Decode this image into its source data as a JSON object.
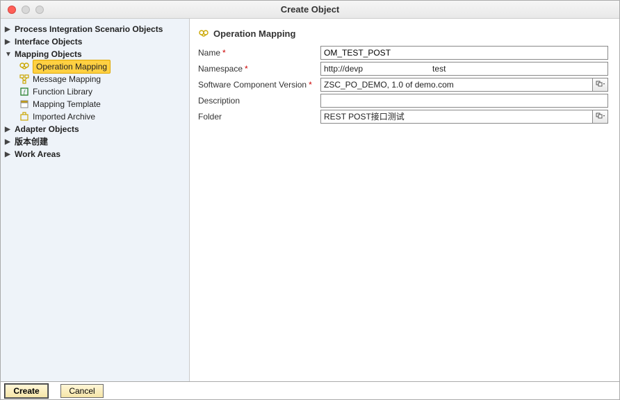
{
  "window": {
    "title": "Create Object"
  },
  "tree": {
    "items": [
      {
        "label": "Process Integration Scenario Objects",
        "expanded": false
      },
      {
        "label": "Interface Objects",
        "expanded": false
      },
      {
        "label": "Mapping Objects",
        "expanded": true,
        "children": [
          {
            "label": "Operation Mapping",
            "icon": "op-mapping",
            "selected": true
          },
          {
            "label": "Message Mapping",
            "icon": "msg-mapping"
          },
          {
            "label": "Function Library",
            "icon": "func-lib"
          },
          {
            "label": "Mapping Template",
            "icon": "map-tmpl"
          },
          {
            "label": "Imported Archive",
            "icon": "imp-arch"
          }
        ]
      },
      {
        "label": "Adapter Objects",
        "expanded": false
      },
      {
        "label": "版本创建",
        "expanded": false
      },
      {
        "label": "Work Areas",
        "expanded": false
      }
    ]
  },
  "section": {
    "title": "Operation Mapping"
  },
  "form": {
    "name": {
      "label": "Name",
      "required": true,
      "value": "OM_TEST_POST"
    },
    "namespace": {
      "label": "Namespace",
      "required": true,
      "value": "http://devp                              test"
    },
    "scv": {
      "label": "Software Component Version",
      "required": true,
      "value": "ZSC_PO_DEMO, 1.0 of demo.com"
    },
    "description": {
      "label": "Description",
      "value": ""
    },
    "folder": {
      "label": "Folder",
      "value": "REST POST接口测试"
    }
  },
  "footer": {
    "create": "Create",
    "cancel": "Cancel"
  }
}
